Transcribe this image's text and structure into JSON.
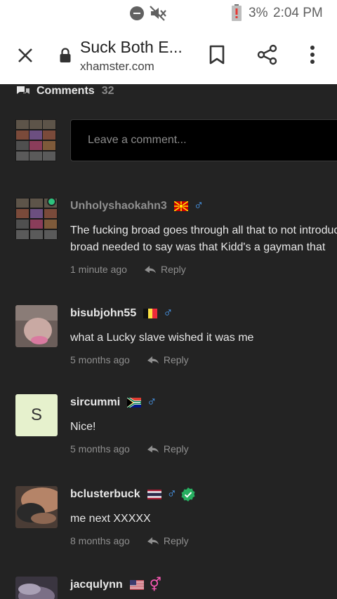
{
  "status_bar": {
    "battery": "3%",
    "time": "2:04 PM",
    "icons": [
      "dnd-icon",
      "mute-icon",
      "battery-alert-icon"
    ]
  },
  "toolbar": {
    "title": "Suck Both E...",
    "url": "xhamster.com"
  },
  "comments": {
    "label": "Comments",
    "count": "32",
    "input_placeholder": "Leave a comment...",
    "reply_label": "Reply",
    "items": [
      {
        "username": "Unholyshaokahn3",
        "country": "mk",
        "gender": "male",
        "online": true,
        "text": "The fucking broad goes through all that to not introduce the",
        "text2": "broad needed to say was that Kidd's a gayman that",
        "time": "1 minute ago"
      },
      {
        "username": "bisubjohn55",
        "country": "be",
        "gender": "male",
        "text": "what a Lucky slave wished it was me",
        "time": "5 months ago"
      },
      {
        "username": "sircummi",
        "country": "za",
        "gender": "male",
        "avatar_letter": "S",
        "text": "Nice!",
        "time": "5 months ago"
      },
      {
        "username": "bclusterbuck",
        "country": "th",
        "gender": "male",
        "verified": true,
        "text": "me next  XXXXX",
        "time": "8 months ago"
      },
      {
        "username": "jacqulynn",
        "country": "us",
        "gender": "female"
      }
    ]
  },
  "colors": {
    "online": "#2ec27e",
    "male": "#4ca3ff",
    "female": "#ff5ab8",
    "verified": "#27ae60"
  }
}
